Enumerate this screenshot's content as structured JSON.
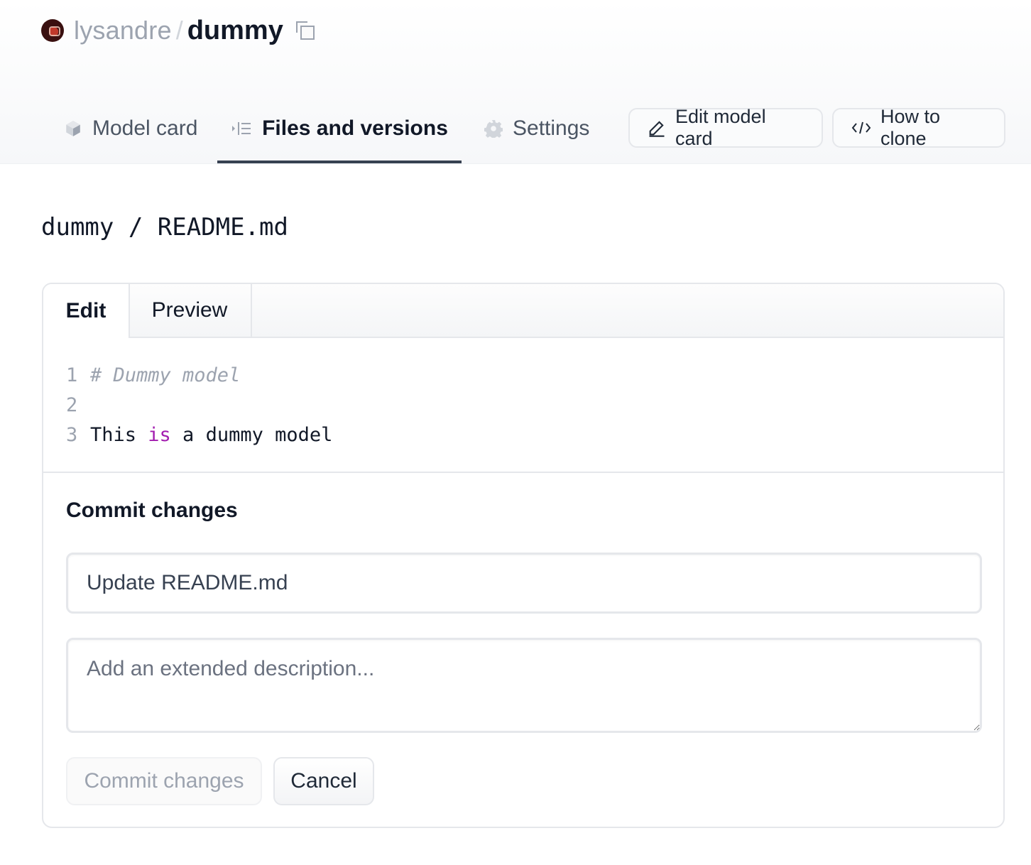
{
  "repo": {
    "owner": "lysandre",
    "separator": "/",
    "name": "dummy"
  },
  "tabs": {
    "model_card": "Model card",
    "files": "Files and versions",
    "settings": "Settings"
  },
  "actions": {
    "edit_model_card": "Edit model card",
    "how_to_clone": "How to clone"
  },
  "breadcrumb": "dummy / README.md",
  "editor": {
    "tabs": {
      "edit": "Edit",
      "preview": "Preview"
    },
    "lines": [
      {
        "num": "1",
        "comment": "# Dummy model"
      },
      {
        "num": "2"
      },
      {
        "num": "3",
        "pre": "This ",
        "keyword": "is",
        "post": " a dummy model"
      }
    ]
  },
  "commit": {
    "title": "Commit changes",
    "summary_value": "Update README.md",
    "description_placeholder": "Add an extended description...",
    "commit_button": "Commit changes",
    "cancel_button": "Cancel"
  },
  "icons": {
    "avatar": "avatar",
    "copy": "copy-icon",
    "model_card": "cube-icon",
    "files": "file-tree-icon",
    "settings": "gear-icon",
    "edit": "pencil-icon",
    "clone": "code-icon"
  }
}
